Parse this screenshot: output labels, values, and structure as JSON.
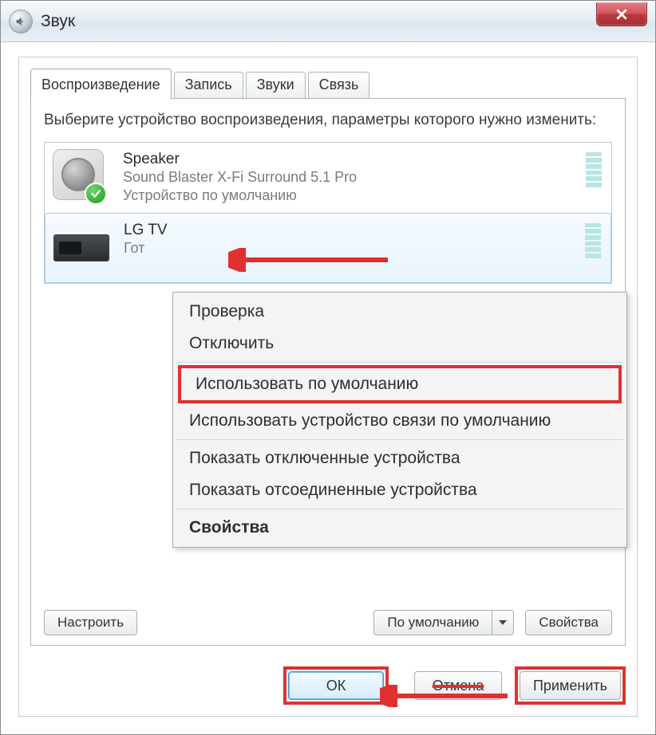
{
  "window": {
    "title": "Звук"
  },
  "tabs": {
    "playback": "Воспроизведение",
    "recording": "Запись",
    "sounds": "Звуки",
    "communications": "Связь"
  },
  "intro": "Выберите устройство воспроизведения, параметры которого нужно изменить:",
  "devices": [
    {
      "name": "Speaker",
      "desc": "Sound Blaster X-Fi Surround 5.1 Pro",
      "status": "Устройство по умолчанию"
    },
    {
      "name": "LG TV",
      "desc": "",
      "status": "Гот"
    }
  ],
  "context_menu": {
    "test": "Проверка",
    "disable": "Отключить",
    "set_default": "Использовать по умолчанию",
    "set_default_comm": "Использовать устройство связи по умолчанию",
    "show_disabled": "Показать отключенные устройства",
    "show_disconnected": "Показать отсоединенные устройства",
    "properties": "Свойства"
  },
  "buttons": {
    "configure": "Настроить",
    "set_default": "По умолчанию",
    "properties": "Свойства",
    "ok": "ОК",
    "cancel": "Отмена",
    "apply": "Применить"
  }
}
